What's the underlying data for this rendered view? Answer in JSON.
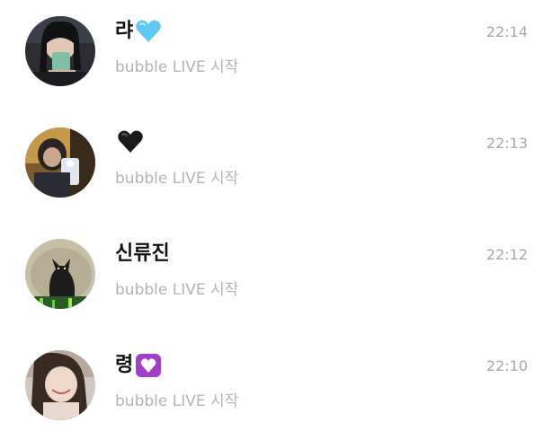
{
  "messages": [
    {
      "name": "랴",
      "emoji": "light-blue-heart-icon",
      "subtitle": "bubble LIVE 시작",
      "time": "22:14"
    },
    {
      "name": "",
      "emoji": "black-heart-icon",
      "subtitle": "bubble LIVE 시작",
      "time": "22:13"
    },
    {
      "name": "신류진",
      "emoji": "",
      "subtitle": "bubble LIVE 시작",
      "time": "22:12"
    },
    {
      "name": "령",
      "emoji": "heart-decoration-icon",
      "subtitle": "bubble LIVE 시작",
      "time": "22:10"
    }
  ],
  "colors": {
    "name": "#111111",
    "subtitle": "#b3b3b3",
    "time": "#a8a8a8",
    "light_blue_heart": "#5ec7f2",
    "black_heart": "#1a1a1a",
    "heart_decoration_bg": "#a23ec9"
  }
}
